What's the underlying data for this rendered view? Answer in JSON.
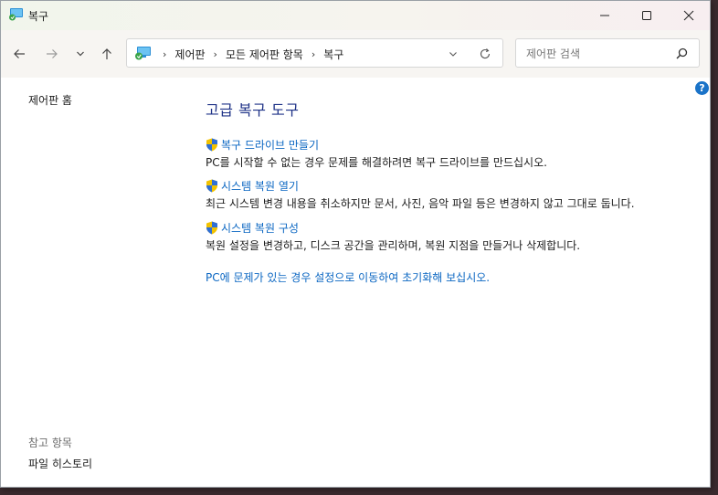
{
  "window": {
    "title": "복구"
  },
  "navigation": {
    "breadcrumbs": [
      "제어판",
      "모든 제어판 항목",
      "복구"
    ],
    "search_placeholder": "제어판 검색"
  },
  "left_pane": {
    "home_link": "제어판 홈",
    "see_also_title": "참고 항목",
    "see_also_items": [
      "파일 히스토리"
    ]
  },
  "main": {
    "heading": "고급 복구 도구",
    "tools": [
      {
        "link": "복구 드라이브 만들기",
        "description": "PC를 시작할 수 없는 경우 문제를 해결하려면 복구 드라이브를 만드십시오."
      },
      {
        "link": "시스템 복원 열기",
        "description": "최근 시스템 변경 내용을 취소하지만 문서, 사진, 음악 파일 등은 변경하지 않고 그대로 둡니다."
      },
      {
        "link": "시스템 복원 구성",
        "description": "복원 설정을 변경하고, 디스크 공간을 관리하며, 복원 지점을 만들거나 삭제합니다."
      }
    ],
    "reset_link": "PC에 문제가 있는 경우 설정으로 이동하여 초기화해 보십시오."
  },
  "icons": {
    "back": "arrow-left-icon",
    "forward": "arrow-right-icon",
    "recent": "chevron-down-icon",
    "up": "arrow-up-icon",
    "refresh": "refresh-icon",
    "search": "search-icon",
    "help": "help-icon",
    "shield": "uac-shield-icon"
  },
  "help_glyph": "?",
  "colors": {
    "link": "#0a66c2",
    "heading": "#1e3287",
    "help": "#1a73c8"
  }
}
